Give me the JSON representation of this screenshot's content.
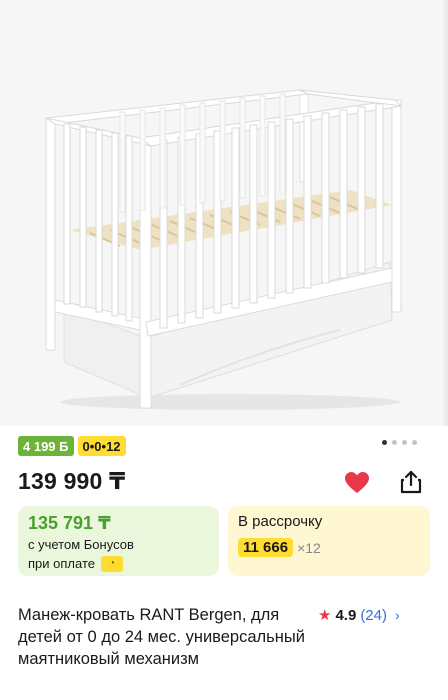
{
  "badges": {
    "bonus": "4 199 Б",
    "installment": "0•0•12"
  },
  "gallery": {
    "dots_count": 4,
    "active_index": 0
  },
  "product": {
    "price": "139 990 ₸",
    "title": "Манеж-кровать RANT Bergen, для детей от 0 до 24 мес. универсальный маятниковый механизм",
    "rating": "4.9",
    "reviews": "(24)"
  },
  "bonus_card": {
    "amount": "135 791 ₸",
    "line1": "с учетом Бонусов",
    "line2": "при оплате"
  },
  "installment_card": {
    "title": "В рассрочку",
    "monthly": "11 666",
    "multiplier": "×12"
  },
  "icons": {
    "favorite": "heart-icon",
    "share": "share-icon",
    "rating": "star-icon",
    "more": "chevron-right-icon"
  },
  "colors": {
    "heart": "#e8394a",
    "bonus_green": "#6cb33a",
    "installment_yellow": "#ffdc30",
    "link_blue": "#3b6fd0"
  }
}
